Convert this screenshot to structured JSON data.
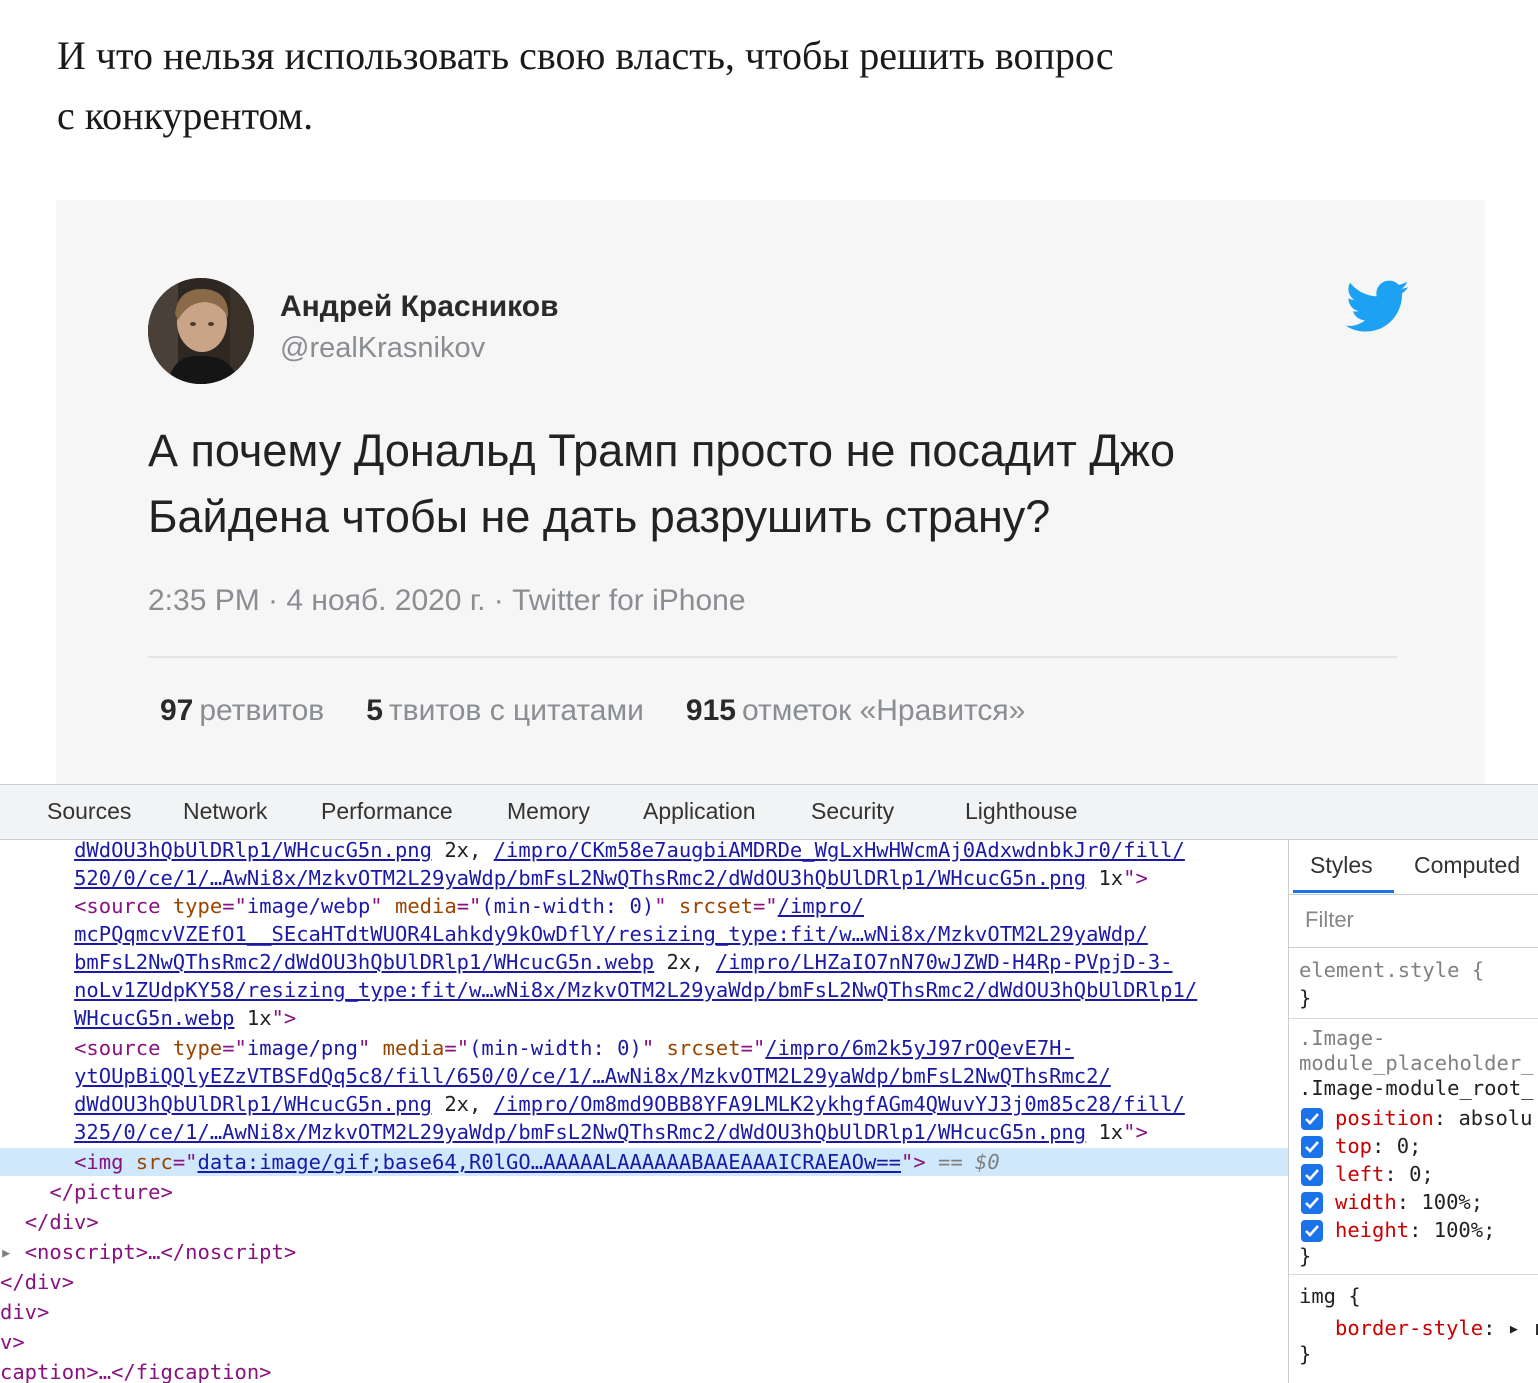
{
  "article": {
    "paragraph_line1": "И что нельзя использовать свою власть, чтобы решить вопрос",
    "paragraph_line2": "с конкурентом."
  },
  "tweet": {
    "author_name": "Андрей Красников",
    "author_handle": "@realKrasnikov",
    "text_line1": "А почему Дональд Трамп просто не посадит Джо",
    "text_line2": "Байдена чтобы не дать разрушить страну?",
    "meta": "2:35 PM · 4 нояб. 2020 г. · Twitter for iPhone",
    "stats": [
      {
        "count": "97",
        "label": "ретвитов"
      },
      {
        "count": "5",
        "label": "твитов с цитатами"
      },
      {
        "count": "915",
        "label": "отметок «Нравится»"
      }
    ],
    "brand_color": "#1da1f2"
  },
  "devtools": {
    "tabs": [
      "Sources",
      "Network",
      "Performance",
      "Memory",
      "Application",
      "Security",
      "Lighthouse"
    ],
    "elements": {
      "l1_link": "dWdOU3hQbUlDRlp1/WHcucG5n.png",
      "l1_desc": " 2x, ",
      "l1_link2": "/impro/CKm58e7augbiAMDRDe_WgLxHwHWcmAj0AdxwdnbkJr0/fill/",
      "l2_link": "520/0/ce/1/…AwNi8x/MzkvOTM2L29yaWdp/bmFsL2NwQThsRmc2/dWdOU3hQbUlDRlp1/WHcucG5n.png",
      "l2_desc": " 1x",
      "s1_type": "image/webp",
      "s1_media": "(min-width: 0)",
      "s1_link1": "/impro/",
      "s1_link2": "mcPQqmcvVZEfO1__SEcaHTdtWUOR4Lahkdy9kOwDflY/resizing_type:fit/w…wNi8x/MzkvOTM2L29yaWdp/",
      "s1_link3": "bmFsL2NwQThsRmc2/dWdOU3hQbUlDRlp1/WHcucG5n.webp",
      "s1_desc1": " 2x, ",
      "s1_link4": "/impro/LHZaIO7nN70wJZWD-H4Rp-PVpjD-3-",
      "s1_link5": "noLv1ZUdpKY58/resizing_type:fit/w…wNi8x/MzkvOTM2L29yaWdp/bmFsL2NwQThsRmc2/dWdOU3hQbUlDRlp1/",
      "s1_link6": "WHcucG5n.webp",
      "s1_desc2": " 1x",
      "s2_type": "image/png",
      "s2_media": "(min-width: 0)",
      "s2_link1": "/impro/6m2k5yJ97rOQevE7H-",
      "s2_link2": "ytOUpBiQQlyEZzVTBSFdQq5c8/fill/650/0/ce/1/…AwNi8x/MzkvOTM2L29yaWdp/bmFsL2NwQThsRmc2/",
      "s2_link3": "dWdOU3hQbUlDRlp1/WHcucG5n.png",
      "s2_desc1": " 2x, ",
      "s2_link4": "/impro/Om8md9OBB8YFA9LMLK2ykhgfAGm4QWuvYJ3j0m85c28/fill/",
      "s2_link5": "325/0/ce/1/…AwNi8x/MzkvOTM2L29yaWdp/bmFsL2NwQThsRmc2/dWdOU3hQbUlDRlp1/WHcucG5n.png",
      "s2_desc2": " 1x",
      "img_src": "data:image/gif;base64,R0lGO…AAAAALAAAAAABAAEAAAICRAEAOw==",
      "sel_marker": "== $0",
      "close_picture": "</picture>",
      "close_div": "</div>",
      "noscript": "<noscript>…</noscript>",
      "close_div2": "</div>",
      "div_frag": "div>",
      "v_frag": "v>",
      "figcaption": "caption>…</figcaption>"
    },
    "styles": {
      "tabs": [
        "Styles",
        "Computed"
      ],
      "filter_placeholder": "Filter",
      "element_style": "element.style {",
      "close_brace": "}",
      "rule1_sel_a": ".Image-",
      "rule1_sel_b": "module_placeholder_",
      "rule1_sel_c": ".Image-module_root_",
      "rule1_props": [
        {
          "name": "position",
          "value": "absolu"
        },
        {
          "name": "top",
          "value": "0;"
        },
        {
          "name": "left",
          "value": "0;"
        },
        {
          "name": "width",
          "value": "100%;"
        },
        {
          "name": "height",
          "value": "100%;"
        }
      ],
      "rule2_sel": "img {",
      "rule2_prop": "border-style",
      "rule2_value": "r"
    }
  }
}
